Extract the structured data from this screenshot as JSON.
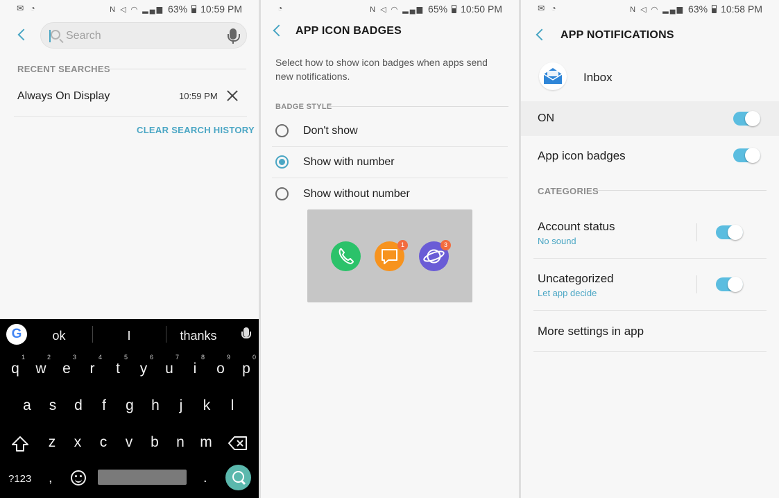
{
  "panel1": {
    "status": {
      "battery": "63%",
      "time": "10:59 PM"
    },
    "search": {
      "placeholder": "Search"
    },
    "recent_header": "RECENT SEARCHES",
    "recent_items": [
      {
        "text": "Always On Display",
        "time": "10:59 PM"
      }
    ],
    "clear_history": "CLEAR SEARCH HISTORY",
    "keyboard": {
      "suggestions": [
        "ok",
        "I",
        "thanks"
      ],
      "row1": [
        {
          "key": "q",
          "hint": "1"
        },
        {
          "key": "w",
          "hint": "2"
        },
        {
          "key": "e",
          "hint": "3"
        },
        {
          "key": "r",
          "hint": "4"
        },
        {
          "key": "t",
          "hint": "5"
        },
        {
          "key": "y",
          "hint": "6"
        },
        {
          "key": "u",
          "hint": "7"
        },
        {
          "key": "i",
          "hint": "8"
        },
        {
          "key": "o",
          "hint": "9"
        },
        {
          "key": "p",
          "hint": "0"
        }
      ],
      "row2": [
        "a",
        "s",
        "d",
        "f",
        "g",
        "h",
        "j",
        "k",
        "l"
      ],
      "row3": [
        "z",
        "x",
        "c",
        "v",
        "b",
        "n",
        "m"
      ],
      "symbols_key": "?123",
      "comma_key": ",",
      "period_key": ".",
      "icons": [
        "google-g-icon",
        "mic-icon",
        "shift-icon",
        "backspace-icon",
        "emoji-icon",
        "search-icon"
      ]
    }
  },
  "panel2": {
    "status": {
      "battery": "65%",
      "time": "10:50 PM"
    },
    "title": "APP ICON BADGES",
    "description": "Select how to show icon badges when apps send new notifications.",
    "section_label": "BADGE STYLE",
    "options": [
      {
        "label": "Don't show",
        "selected": false
      },
      {
        "label": "Show with number",
        "selected": true
      },
      {
        "label": "Show without number",
        "selected": false
      }
    ],
    "preview_badges": [
      {
        "app": "phone-icon",
        "badge": ""
      },
      {
        "app": "messages-icon",
        "badge": "1"
      },
      {
        "app": "internet-icon",
        "badge": "3"
      }
    ]
  },
  "panel3": {
    "status": {
      "battery": "63%",
      "time": "10:58 PM"
    },
    "title": "APP NOTIFICATIONS",
    "app_name": "Inbox",
    "on_label": "ON",
    "on_enabled": true,
    "badges_label": "App icon badges",
    "badges_enabled": true,
    "categories_label": "CATEGORIES",
    "categories": [
      {
        "name": "Account status",
        "sub": "No sound",
        "enabled": true
      },
      {
        "name": "Uncategorized",
        "sub": "Let app decide",
        "enabled": true
      }
    ],
    "more_settings": "More settings in app"
  },
  "colors": {
    "accent": "#4aa6c4",
    "toggle": "#5bbde0",
    "badge": "#f26c3f",
    "keyboard_bg": "#000000"
  }
}
